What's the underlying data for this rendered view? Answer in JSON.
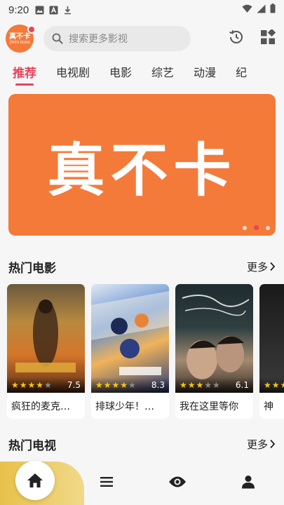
{
  "status": {
    "time": "9:20"
  },
  "app": {
    "logo_text": "真不卡",
    "logo_sub": "ZHEN BUKA"
  },
  "search": {
    "placeholder": "搜索更多影视"
  },
  "tabs": [
    "推荐",
    "电视剧",
    "电影",
    "综艺",
    "动漫",
    "纪"
  ],
  "banner": {
    "text": "真不卡"
  },
  "sections": {
    "movies": {
      "title": "热门电影",
      "more": "更多"
    },
    "tv": {
      "title": "热门电视",
      "more": "更多"
    }
  },
  "movies": [
    {
      "title": "疯狂的麦克…",
      "score": "7.5",
      "stars": 3.5
    },
    {
      "title": "排球少年！…",
      "score": "8.3",
      "stars": 4
    },
    {
      "title": "我在这里等你",
      "score": "6.1",
      "stars": 3
    },
    {
      "title": "神",
      "score": "",
      "stars": 4
    }
  ],
  "colors": {
    "accent": "#e8435a",
    "brand": "#f47a3a",
    "star": "#f5c518"
  },
  "icons": {
    "history": "history-icon",
    "category": "apps-icon",
    "nav": [
      "home-icon",
      "list-icon",
      "eye-icon",
      "user-icon"
    ]
  }
}
